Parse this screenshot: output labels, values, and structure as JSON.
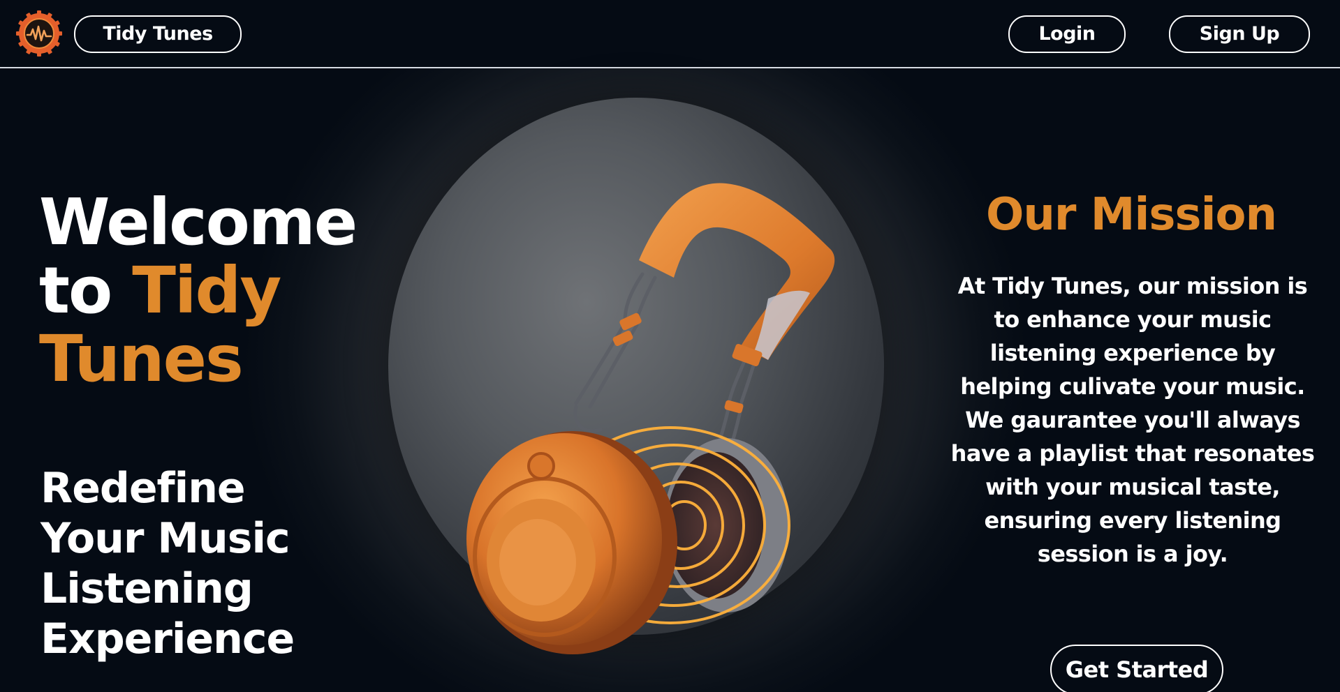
{
  "colors": {
    "background": "#050b14",
    "accent": "#e08a2c",
    "text": "#ffffff"
  },
  "header": {
    "logo_icon": "soundwave-badge-icon",
    "brand_label": "Tidy Tunes",
    "login_label": "Login",
    "signup_label": "Sign Up"
  },
  "hero": {
    "welcome_line1": "Welcome",
    "welcome_line2_prefix": "to ",
    "welcome_accent": "Tidy Tunes",
    "tagline": "Redefine Your Music Listening Experience",
    "image_icon": "headphones-icon"
  },
  "mission": {
    "title": "Our Mission",
    "body": "At Tidy Tunes, our mission is to enhance your music listening experience by helping culivate your music. We gaurantee you'll always have a playlist that resonates with your musical taste, ensuring every listening session is a joy.",
    "cta_label": "Get Started"
  }
}
